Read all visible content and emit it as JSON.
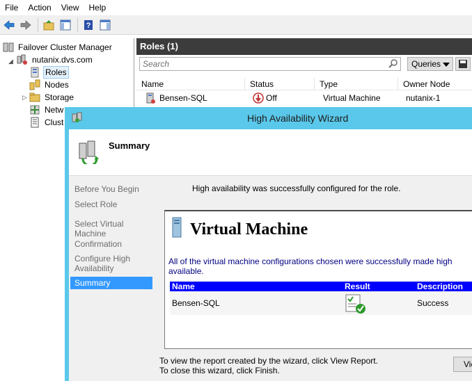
{
  "menu": {
    "file": "File",
    "action": "Action",
    "view": "View",
    "help": "Help"
  },
  "toolbar": {
    "back_icon": "back-arrow-icon",
    "forward_icon": "forward-arrow-icon",
    "up_icon": "up-folder-icon",
    "show_hide_icon": "show-hide-console-tree-icon",
    "help_icon": "help-icon",
    "action_pane_icon": "action-pane-icon"
  },
  "tree": {
    "root": "Failover Cluster Manager",
    "cluster": "nutanix.dvs.com",
    "items": [
      "Roles",
      "Nodes",
      "Storage",
      "Netw",
      "Clust"
    ]
  },
  "roles_panel": {
    "title": "Roles (1)",
    "search_placeholder": "Search",
    "queries_label": "Queries",
    "columns": [
      "Name",
      "Status",
      "Type",
      "Owner Node"
    ],
    "rows": [
      {
        "name": "Bensen-SQL",
        "status": "Off",
        "type": "Virtual Machine",
        "owner": "nutanix-1"
      }
    ]
  },
  "wizard": {
    "title": "High Availability Wizard",
    "header_title": "Summary",
    "nav": [
      "Before You Begin",
      "Select Role",
      "Select Virtual Machine",
      "Confirmation",
      "Configure High Availability",
      "Summary"
    ],
    "active_step": "Summary",
    "message": "High availability was successfully configured for the role.",
    "report": {
      "title": "Virtual Machine",
      "description": "All of the virtual machine configurations chosen were successfully made high available.",
      "columns": [
        "Name",
        "Result",
        "Description"
      ],
      "rows": [
        {
          "name": "Bensen-SQL",
          "result_icon": "success-check-icon",
          "description": "Success"
        }
      ]
    },
    "footer_line1": "To view the report created by the wizard, click View Report.",
    "footer_line2": "To close this wizard, click Finish.",
    "view_report_button": "View Report..."
  }
}
